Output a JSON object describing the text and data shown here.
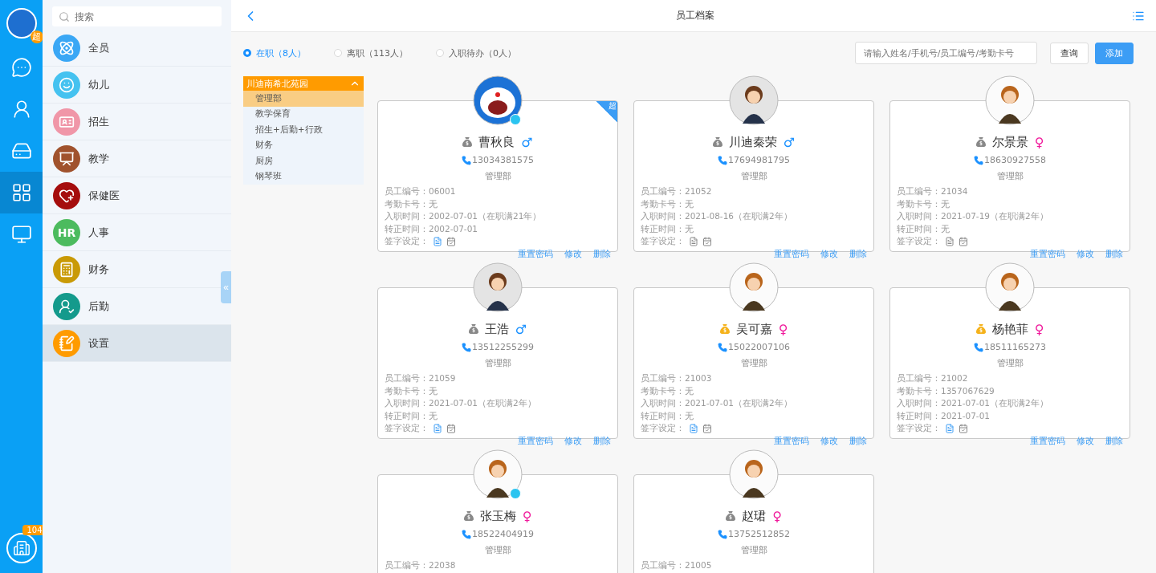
{
  "rail": {
    "avatar_badge": "超",
    "items": [
      {
        "kind": "chat",
        "selected": false
      },
      {
        "kind": "contacts",
        "selected": false
      },
      {
        "kind": "drive",
        "selected": false
      },
      {
        "kind": "apps",
        "selected": true
      },
      {
        "kind": "monitor",
        "selected": false
      }
    ],
    "bottom_badge": "104"
  },
  "menu": {
    "search_placeholder": "搜索",
    "collapse_handle": "«",
    "items": [
      {
        "label": "全员",
        "kind": "atom",
        "color": "#3aa7f5",
        "selected": false
      },
      {
        "label": "幼儿",
        "kind": "smile",
        "color": "#45c2f0",
        "selected": false
      },
      {
        "label": "招生",
        "kind": "card",
        "color": "#f096a8",
        "selected": false
      },
      {
        "label": "教学",
        "kind": "teach",
        "color": "#a0522d",
        "selected": false
      },
      {
        "label": "保健医",
        "kind": "heart",
        "color": "#a50d0d",
        "selected": false
      },
      {
        "label": "人事",
        "kind": "text",
        "icon_text": "HR",
        "color": "#4cbb5e",
        "selected": false
      },
      {
        "label": "财务",
        "kind": "calc",
        "color": "#c99a06",
        "selected": false
      },
      {
        "label": "后勤",
        "kind": "person",
        "color": "#149a8c",
        "selected": false
      },
      {
        "label": "设置",
        "kind": "note",
        "color": "#ff9b00",
        "selected": true
      }
    ]
  },
  "header": {
    "title": "员工档案"
  },
  "status_filter": [
    {
      "label": "在职（8人）",
      "selected": true
    },
    {
      "label": "离职（113人）",
      "selected": false
    },
    {
      "label": "入职待办（0人）",
      "selected": false
    }
  ],
  "search": {
    "placeholder": "请输入姓名/手机号/员工编号/考勤卡号"
  },
  "buttons": [
    {
      "label": "查询",
      "kind": "plain"
    },
    {
      "label": "添加",
      "kind": "primary"
    }
  ],
  "departments": {
    "label": "川迪南希北苑园",
    "expanded": true,
    "children": [
      {
        "label": "管理部",
        "selected": true
      },
      {
        "label": "教学保育",
        "selected": false
      },
      {
        "label": "招生+后勤+行政",
        "selected": false
      },
      {
        "label": "财务",
        "selected": false
      },
      {
        "label": "厨房",
        "selected": false
      },
      {
        "label": "钢琴班",
        "selected": false
      }
    ]
  },
  "employees": [
    {
      "name": "曹秋良",
      "avatar": {
        "kind": "cartoon"
      },
      "online": true,
      "corner_badge": "超",
      "salary_set": false,
      "gender": {
        "kind": "male",
        "symbol": "♂"
      },
      "phone": "13034381575",
      "department": "管理部",
      "fields": [
        "员工编号：06001",
        "考勤卡号：无",
        "入职时间：2002-07-01（在职满21年）",
        "转正时间：2002-07-01"
      ],
      "signature_label": "签字设定：",
      "sign_money": true,
      "sign_leave": false,
      "actions": [
        "重置密码",
        "修改",
        "删除"
      ]
    },
    {
      "name": "川迪秦荣",
      "avatar": {
        "kind": "man"
      },
      "online": false,
      "salary_set": false,
      "gender": {
        "kind": "male",
        "symbol": "♂"
      },
      "phone": "17694981795",
      "department": "管理部",
      "fields": [
        "员工编号：21052",
        "考勤卡号：无",
        "入职时间：2021-08-16（在职满2年）",
        "转正时间：无"
      ],
      "signature_label": "签字设定：",
      "sign_money": false,
      "sign_leave": false,
      "actions": [
        "重置密码",
        "修改",
        "删除"
      ]
    },
    {
      "name": "尔景景",
      "avatar": {
        "kind": "woman"
      },
      "online": false,
      "salary_set": false,
      "gender": {
        "kind": "female",
        "symbol": "♀"
      },
      "phone": "18630927558",
      "department": "管理部",
      "fields": [
        "员工编号：21034",
        "考勤卡号：无",
        "入职时间：2021-07-19（在职满2年）",
        "转正时间：无"
      ],
      "signature_label": "签字设定：",
      "sign_money": false,
      "sign_leave": false,
      "actions": [
        "重置密码",
        "修改",
        "删除"
      ]
    },
    {
      "name": "王浩",
      "avatar": {
        "kind": "man"
      },
      "online": false,
      "salary_set": false,
      "gender": {
        "kind": "male",
        "symbol": "♂"
      },
      "phone": "13512255299",
      "department": "管理部",
      "fields": [
        "员工编号：21059",
        "考勤卡号：无",
        "入职时间：2021-07-01（在职满2年）",
        "转正时间：无"
      ],
      "signature_label": "签字设定：",
      "sign_money": true,
      "sign_leave": false,
      "actions": [
        "重置密码",
        "修改",
        "删除"
      ]
    },
    {
      "name": "吴可嘉",
      "avatar": {
        "kind": "woman"
      },
      "online": false,
      "salary_set": true,
      "gender": {
        "kind": "female",
        "symbol": "♀"
      },
      "phone": "15022007106",
      "department": "管理部",
      "fields": [
        "员工编号：21003",
        "考勤卡号：无",
        "入职时间：2021-07-01（在职满2年）",
        "转正时间：无"
      ],
      "signature_label": "签字设定：",
      "sign_money": true,
      "sign_leave": false,
      "actions": [
        "重置密码",
        "修改",
        "删除"
      ]
    },
    {
      "name": "杨艳菲",
      "avatar": {
        "kind": "woman"
      },
      "online": false,
      "salary_set": true,
      "gender": {
        "kind": "female",
        "symbol": "♀"
      },
      "phone": "18511165273",
      "department": "管理部",
      "fields": [
        "员工编号：21002",
        "考勤卡号：1357067629",
        "入职时间：2021-07-01（在职满2年）",
        "转正时间：2021-07-01"
      ],
      "signature_label": "签字设定：",
      "sign_money": true,
      "sign_leave": false,
      "actions": [
        "重置密码",
        "修改",
        "删除"
      ]
    },
    {
      "name": "张玉梅",
      "avatar": {
        "kind": "woman"
      },
      "online": true,
      "salary_set": false,
      "gender": {
        "kind": "female",
        "symbol": "♀"
      },
      "phone": "18522404919",
      "department": "管理部",
      "fields": [
        "员工编号：22038"
      ]
    },
    {
      "name": "赵珺",
      "avatar": {
        "kind": "woman"
      },
      "online": false,
      "salary_set": false,
      "gender": {
        "kind": "female",
        "symbol": "♀"
      },
      "phone": "13752512852",
      "department": "管理部",
      "fields": [
        "员工编号：21005"
      ]
    }
  ]
}
